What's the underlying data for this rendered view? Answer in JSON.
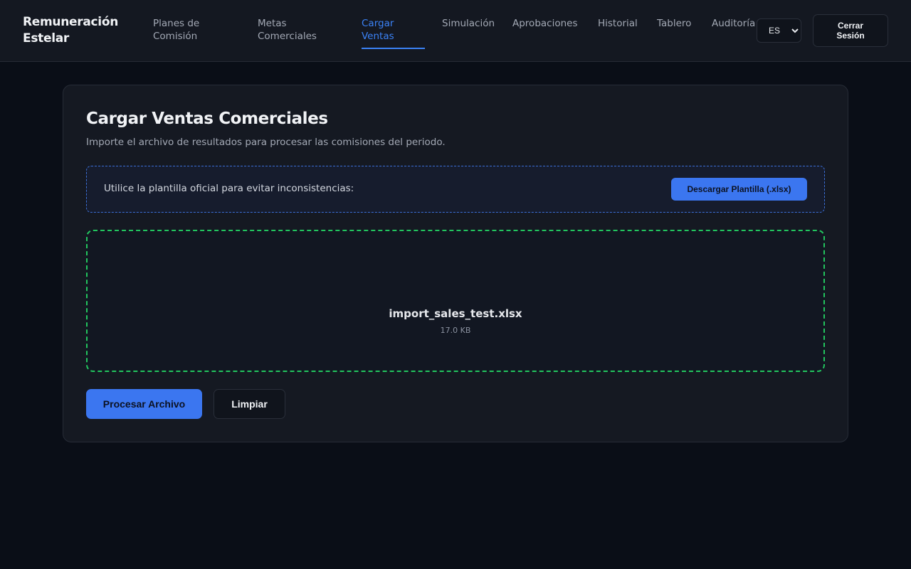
{
  "app": {
    "brand": "Remuneración Estelar"
  },
  "nav": {
    "items": [
      {
        "label": "Planes de Comisión",
        "active": false
      },
      {
        "label": "Metas Comerciales",
        "active": false
      },
      {
        "label": "Cargar Ventas",
        "active": true
      },
      {
        "label": "Simulación",
        "active": false
      },
      {
        "label": "Aprobaciones",
        "active": false
      },
      {
        "label": "Historial",
        "active": false
      },
      {
        "label": "Tablero",
        "active": false
      },
      {
        "label": "Auditoría",
        "active": false
      }
    ]
  },
  "header": {
    "language": {
      "selected": "ES",
      "options": [
        "ES"
      ]
    },
    "logout_label": "Cerrar Sesión"
  },
  "page": {
    "title": "Cargar Ventas Comerciales",
    "subtitle": "Importe el archivo de resultados para procesar las comisiones del periodo.",
    "template": {
      "text": "Utilice la plantilla oficial para evitar inconsistencias:",
      "button_label": "Descargar Plantilla (.xlsx)"
    },
    "upload": {
      "icon": "file-icon",
      "icon_glyph": "",
      "file_name": "import_sales_test.xlsx",
      "file_size": "17.0 KB"
    },
    "actions": {
      "process_label": "Procesar Archivo",
      "clear_label": "Limpiar"
    }
  },
  "colors": {
    "accent": "#3b82f6",
    "dropzone_border": "#22c55e",
    "background": "#0a0e17",
    "surface": "#151922"
  }
}
